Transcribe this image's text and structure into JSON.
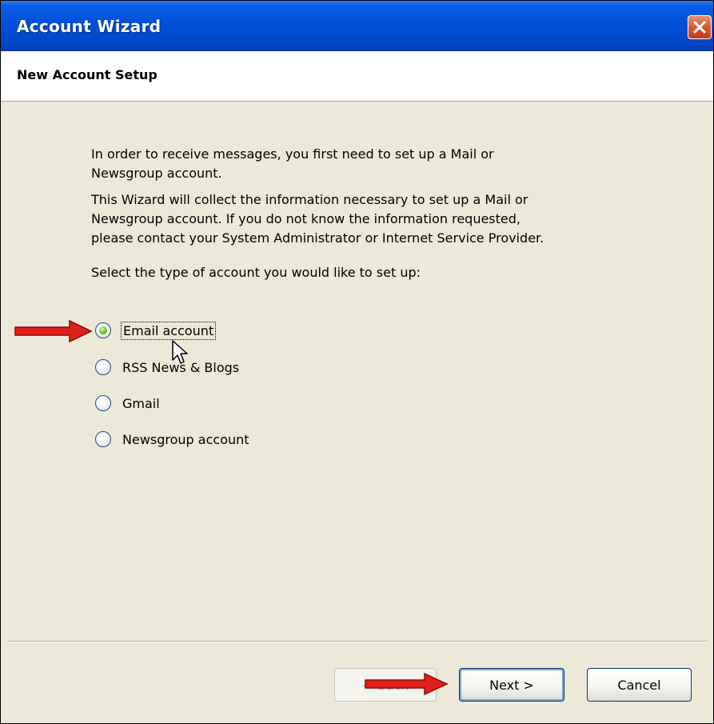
{
  "window": {
    "title": "Account Wizard",
    "close_icon": "close-icon"
  },
  "header": {
    "heading": "New Account Setup"
  },
  "intro": {
    "line1": "In order to receive messages, you first need to set up a Mail or",
    "line2": "Newsgroup account.",
    "line3": "This Wizard will collect the information necessary to set up a Mail or",
    "line4": "Newsgroup account. If you do not know the information requested,",
    "line5": "please contact your System Administrator or Internet Service Provider.",
    "prompt": "Select the type of account you would like to set up:"
  },
  "options": [
    {
      "label": "Email account",
      "selected": true
    },
    {
      "label": "RSS News & Blogs",
      "selected": false
    },
    {
      "label": "Gmail",
      "selected": false
    },
    {
      "label": "Newsgroup account",
      "selected": false
    }
  ],
  "buttons": {
    "back": "< Back",
    "next": "Next >",
    "cancel": "Cancel"
  },
  "colors": {
    "titlebar": "#0050d8",
    "dialog_bg": "#ece9d8",
    "annotation_arrow": "#e0201b",
    "radio_selected": "#57c01d"
  }
}
